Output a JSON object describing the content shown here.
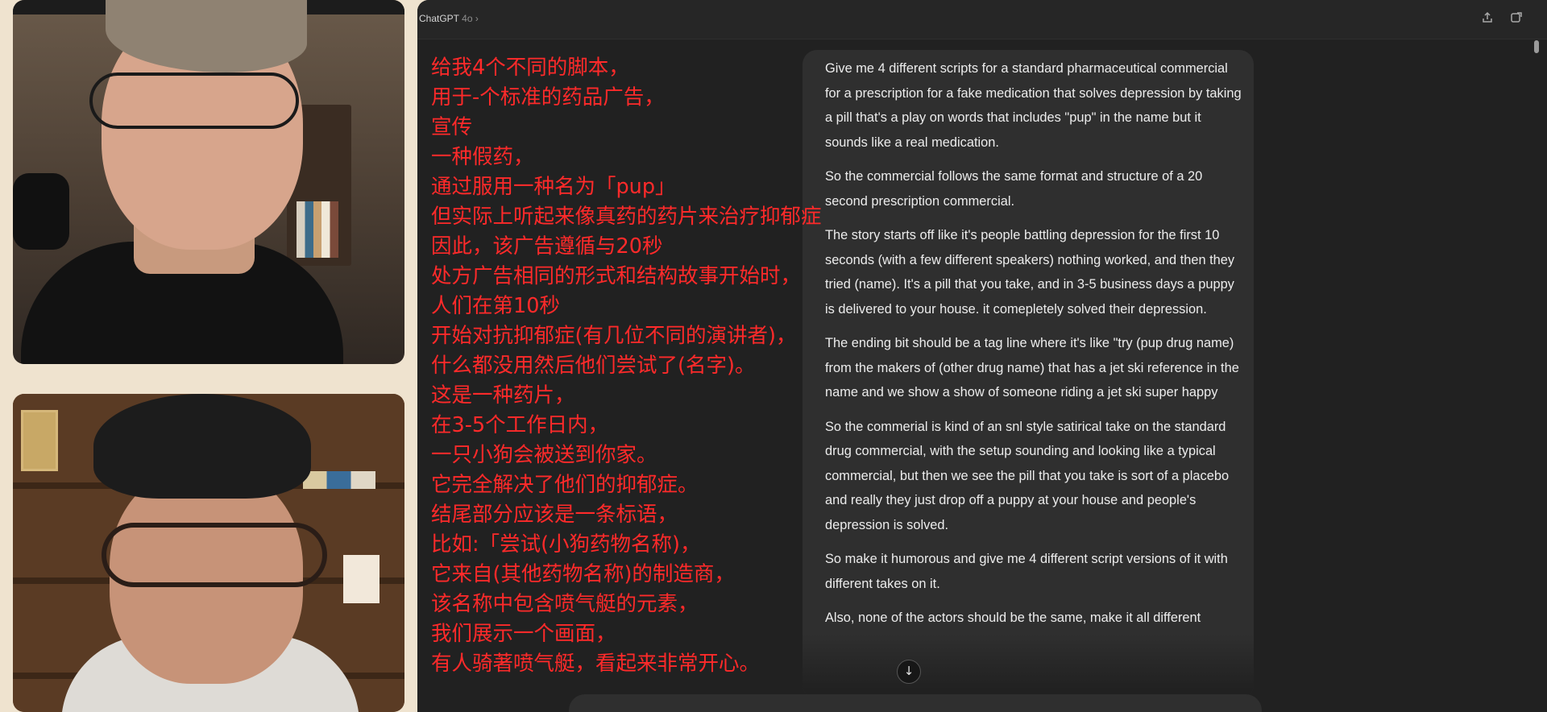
{
  "chat": {
    "model_name": "ChatGPT",
    "model_version": "4o ›",
    "share_icon": "share-icon",
    "new_chat_icon": "new-chat-icon",
    "scroll_down_icon": "↓",
    "user_message": [
      "Give me 4 different scripts for a standard pharmaceutical commercial for a prescription for a fake medication that solves depression by taking a pill that's a play on words that includes \"pup\" in the name but it sounds like a real medication.",
      "So the commercial follows the same format and structure of a 20 second prescription commercial.",
      "The story starts off like it's people battling depression for the first 10 seconds (with a few different speakers) nothing worked, and then they tried (name). It's a pill that you take, and in 3-5 business days a puppy is delivered to your house. it comepletely solved their depression.",
      "The ending bit should be a tag line where it's like \"try (pup drug name) from the makers of (other drug name) that has a jet ski reference in the name and we show a show of someone riding a jet ski super happy",
      "So the commerial is kind of an snl style satirical take on the standard drug commercial, with the setup sounding and looking like a typical commercial, but then we see the pill that you take is sort of a placebo and really they just drop off a puppy at your house and people's depression is solved.",
      "So make it humorous and give me 4 different script versions of it with different takes on it.",
      "Also, none of the actors should be the same, make it all different"
    ]
  },
  "subtitles": [
    "给我4个不同的脚本，",
    "用于-个标准的药品广告，",
    "宣传",
    "一种假药，",
    "通过服用一种名为「pup」",
    "但实际上听起来像真药的药片来治疗抑郁症",
    "因此，该广告遵循与20秒",
    "处方广告相同的形式和结构故事开始时，",
    "人们在第10秒",
    "开始对抗抑郁症(有几位不同的演讲者)，",
    "什么都没用然后他们尝试了(名字)。",
    "这是一种药片，",
    "在3-5个工作日内，",
    "一只小狗会被送到你家。",
    "它完全解决了他们的抑郁症。",
    "结尾部分应该是一条标语，",
    "比如:「尝试(小狗药物名称)，",
    "它来自(其他药物名称)的制造商，",
    "该名称中包含喷气艇的元素，",
    "我们展示一个画面，",
    "有人骑著喷气艇，看起来非常开心。"
  ],
  "colors": {
    "subtitle": "#ff2a2a",
    "chat_background": "#212121",
    "bubble": "#2f2f2f",
    "outer_background": "#efe3cf"
  }
}
